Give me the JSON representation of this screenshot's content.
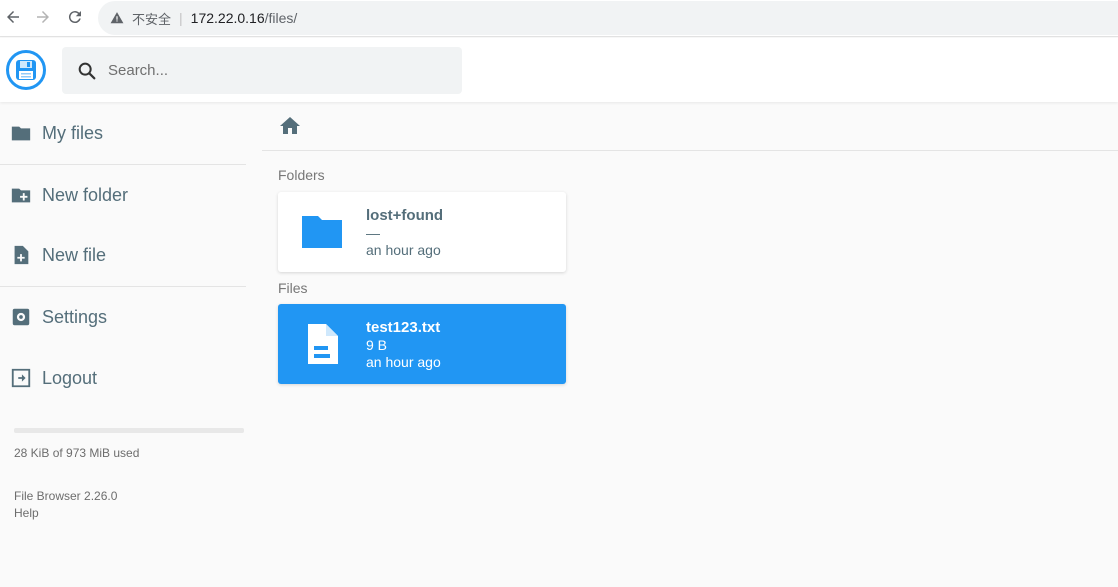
{
  "browser": {
    "insecure_label": "不安全",
    "url_host": "172.22.0.16",
    "url_path": "/files/"
  },
  "search": {
    "placeholder": "Search..."
  },
  "sidebar": {
    "items": [
      {
        "label": "My files",
        "icon": "folder-icon"
      },
      {
        "label": "New folder",
        "icon": "create-new-folder-icon"
      },
      {
        "label": "New file",
        "icon": "note-add-icon"
      },
      {
        "label": "Settings",
        "icon": "settings-icon"
      },
      {
        "label": "Logout",
        "icon": "exit-icon"
      }
    ],
    "usage_text": "28 KiB of 973 MiB used",
    "usage_fraction": 3e-05,
    "version": "File Browser 2.26.0",
    "help": "Help"
  },
  "main": {
    "folders_label": "Folders",
    "files_label": "Files",
    "folders": [
      {
        "name": "lost+found",
        "size": "—",
        "modified": "an hour ago"
      }
    ],
    "files": [
      {
        "name": "test123.txt",
        "size": "9 B",
        "modified": "an hour ago",
        "selected": true
      }
    ]
  },
  "colors": {
    "accent": "#2196f3",
    "text": "#546e7a"
  }
}
